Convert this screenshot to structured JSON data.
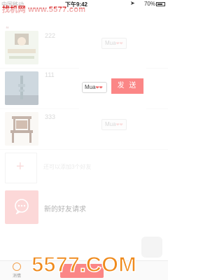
{
  "watermark_top": "找机网 www.5577.com",
  "status_bar": {
    "carrier": "中国移动",
    "time": "下午9:42",
    "battery": "70%"
  },
  "list": {
    "rows": [
      {
        "title": "222",
        "chip": "Mua",
        "date": ""
      },
      {
        "title": "111",
        "chip": "Mua",
        "date": ""
      },
      {
        "title": "333",
        "chip": "Mua",
        "date": ""
      }
    ],
    "add_text": "还可以添加3个好友",
    "new_friend_text": "新的好友请求"
  },
  "popup": {
    "chip": "Mua",
    "send_label": "发 送"
  },
  "tabbar": {
    "home_label": "消情"
  },
  "watermark_bottom": "5577.COM",
  "colors": {
    "accent": "#fb8686",
    "watermark": "#ef8a1c"
  }
}
